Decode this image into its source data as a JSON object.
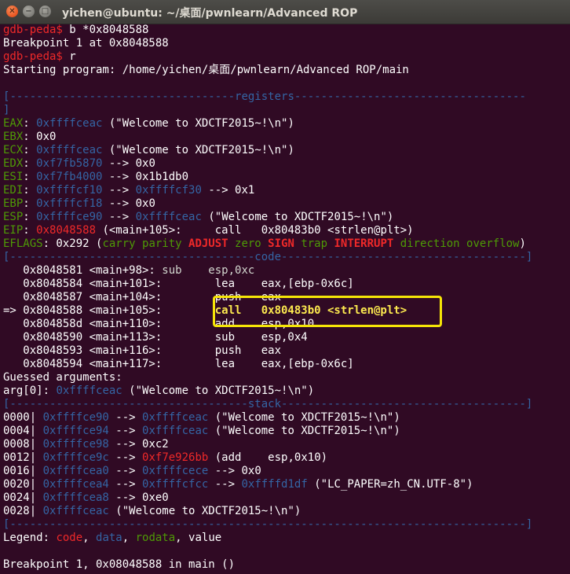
{
  "window": {
    "title": "yichen@ubuntu: ~/桌面/pwnlearn/Advanced ROP",
    "close_glyph": "✕",
    "min_glyph": "−",
    "max_glyph": "□"
  },
  "lines": [
    [
      {
        "t": "gdb-peda$ ",
        "c": "red"
      },
      {
        "t": "b *0x8048588",
        "c": "white"
      }
    ],
    [
      {
        "t": "Breakpoint 1 at 0x8048588",
        "c": "white"
      }
    ],
    [
      {
        "t": "gdb-peda$ ",
        "c": "red"
      },
      {
        "t": "r",
        "c": "white"
      }
    ],
    [
      {
        "t": "Starting program: /home/yichen/桌面/pwnlearn/Advanced ROP/main",
        "c": "white"
      }
    ],
    [
      {
        "t": "",
        "c": "white"
      }
    ],
    [
      {
        "t": "[",
        "c": "blue"
      },
      {
        "t": "----------------------------------registers-----------------------------------",
        "c": "blue"
      }
    ],
    [
      {
        "t": "]",
        "c": "blue"
      }
    ],
    [
      {
        "t": "EAX",
        "c": "green"
      },
      {
        "t": ": ",
        "c": "white"
      },
      {
        "t": "0xffffceac",
        "c": "blue"
      },
      {
        "t": " (\"Welcome to XDCTF2015~!\\n\")",
        "c": "white"
      }
    ],
    [
      {
        "t": "EBX",
        "c": "green"
      },
      {
        "t": ": 0x0",
        "c": "white"
      }
    ],
    [
      {
        "t": "ECX",
        "c": "green"
      },
      {
        "t": ": ",
        "c": "white"
      },
      {
        "t": "0xffffceac",
        "c": "blue"
      },
      {
        "t": " (\"Welcome to XDCTF2015~!\\n\")",
        "c": "white"
      }
    ],
    [
      {
        "t": "EDX",
        "c": "green"
      },
      {
        "t": ": ",
        "c": "white"
      },
      {
        "t": "0xf7fb5870",
        "c": "blue"
      },
      {
        "t": " --> 0x0",
        "c": "white"
      }
    ],
    [
      {
        "t": "ESI",
        "c": "green"
      },
      {
        "t": ": ",
        "c": "white"
      },
      {
        "t": "0xf7fb4000",
        "c": "blue"
      },
      {
        "t": " --> 0x1b1db0",
        "c": "white"
      }
    ],
    [
      {
        "t": "EDI",
        "c": "green"
      },
      {
        "t": ": ",
        "c": "white"
      },
      {
        "t": "0xffffcf10",
        "c": "blue"
      },
      {
        "t": " --> ",
        "c": "white"
      },
      {
        "t": "0xffffcf30",
        "c": "blue"
      },
      {
        "t": " --> 0x1",
        "c": "white"
      }
    ],
    [
      {
        "t": "EBP",
        "c": "green"
      },
      {
        "t": ": ",
        "c": "white"
      },
      {
        "t": "0xffffcf18",
        "c": "blue"
      },
      {
        "t": " --> 0x0",
        "c": "white"
      }
    ],
    [
      {
        "t": "ESP",
        "c": "green"
      },
      {
        "t": ": ",
        "c": "white"
      },
      {
        "t": "0xffffce90",
        "c": "blue"
      },
      {
        "t": " --> ",
        "c": "white"
      },
      {
        "t": "0xffffceac",
        "c": "blue"
      },
      {
        "t": " (\"Welcome to XDCTF2015~!\\n\")",
        "c": "white"
      }
    ],
    [
      {
        "t": "EIP",
        "c": "green"
      },
      {
        "t": ": ",
        "c": "white"
      },
      {
        "t": "0x8048588",
        "c": "red"
      },
      {
        "t": " (<main+105>:     call   0x80483b0 <strlen@plt>)",
        "c": "white"
      }
    ],
    [
      {
        "t": "EFLAGS",
        "c": "green"
      },
      {
        "t": ": 0x292 (",
        "c": "white"
      },
      {
        "t": "carry parity ",
        "c": "green"
      },
      {
        "t": "ADJUST",
        "c": "red-b"
      },
      {
        "t": " zero ",
        "c": "green"
      },
      {
        "t": "SIGN",
        "c": "red-b"
      },
      {
        "t": " trap ",
        "c": "green"
      },
      {
        "t": "INTERRUPT",
        "c": "red-b"
      },
      {
        "t": " direction overflow",
        "c": "green"
      },
      {
        "t": ")",
        "c": "white"
      }
    ],
    [
      {
        "t": "[-------------------------------------code-------------------------------------]",
        "c": "blue"
      }
    ],
    [
      {
        "t": "   0x8048581 <main+98>:",
        "c": "white"
      },
      {
        "t": " sub    esp,0xc",
        "c": "gray"
      }
    ],
    [
      {
        "t": "   0x8048584 <main+101>:        lea    eax,[ebp-0x6c]",
        "c": "white"
      }
    ],
    [
      {
        "t": "   0x8048587 <main+104>:        push   eax",
        "c": "white"
      }
    ],
    [
      {
        "t": "=> 0x8048588 <main+105>:        ",
        "c": "white"
      },
      {
        "t": "call   0x80483b0 <strlen@plt>",
        "c": "yellow-b"
      }
    ],
    [
      {
        "t": "   0x804858d <main+110>:        add    esp,0x10",
        "c": "white"
      }
    ],
    [
      {
        "t": "   0x8048590 <main+113>:        sub    esp,0x4",
        "c": "white"
      }
    ],
    [
      {
        "t": "   0x8048593 <main+116>:        push   eax",
        "c": "white"
      }
    ],
    [
      {
        "t": "   0x8048594 <main+117>:        lea    eax,[ebp-0x6c]",
        "c": "white"
      }
    ],
    [
      {
        "t": "Guessed arguments:",
        "c": "white"
      }
    ],
    [
      {
        "t": "arg[0]: ",
        "c": "white"
      },
      {
        "t": "0xffffceac",
        "c": "blue"
      },
      {
        "t": " (\"Welcome to XDCTF2015~!\\n\")",
        "c": "white"
      }
    ],
    [
      {
        "t": "[------------------------------------stack-------------------------------------]",
        "c": "blue"
      }
    ],
    [
      {
        "t": "0000| ",
        "c": "white"
      },
      {
        "t": "0xffffce90",
        "c": "blue"
      },
      {
        "t": " --> ",
        "c": "white"
      },
      {
        "t": "0xffffceac",
        "c": "blue"
      },
      {
        "t": " (\"Welcome to XDCTF2015~!\\n\")",
        "c": "white"
      }
    ],
    [
      {
        "t": "0004| ",
        "c": "white"
      },
      {
        "t": "0xffffce94",
        "c": "blue"
      },
      {
        "t": " --> ",
        "c": "white"
      },
      {
        "t": "0xffffceac",
        "c": "blue"
      },
      {
        "t": " (\"Welcome to XDCTF2015~!\\n\")",
        "c": "white"
      }
    ],
    [
      {
        "t": "0008| ",
        "c": "white"
      },
      {
        "t": "0xffffce98",
        "c": "blue"
      },
      {
        "t": " --> 0xc2",
        "c": "white"
      }
    ],
    [
      {
        "t": "0012| ",
        "c": "white"
      },
      {
        "t": "0xffffce9c",
        "c": "blue"
      },
      {
        "t": " --> ",
        "c": "white"
      },
      {
        "t": "0xf7e926bb",
        "c": "red"
      },
      {
        "t": " (add    esp,0x10)",
        "c": "white"
      }
    ],
    [
      {
        "t": "0016| ",
        "c": "white"
      },
      {
        "t": "0xffffcea0",
        "c": "blue"
      },
      {
        "t": " --> ",
        "c": "white"
      },
      {
        "t": "0xffffcece",
        "c": "blue"
      },
      {
        "t": " --> 0x0",
        "c": "white"
      }
    ],
    [
      {
        "t": "0020| ",
        "c": "white"
      },
      {
        "t": "0xffffcea4",
        "c": "blue"
      },
      {
        "t": " --> ",
        "c": "white"
      },
      {
        "t": "0xffffcfcc",
        "c": "blue"
      },
      {
        "t": " --> ",
        "c": "white"
      },
      {
        "t": "0xffffd1df",
        "c": "blue"
      },
      {
        "t": " (\"LC_PAPER=zh_CN.UTF-8\")",
        "c": "white"
      }
    ],
    [
      {
        "t": "0024| ",
        "c": "white"
      },
      {
        "t": "0xffffcea8",
        "c": "blue"
      },
      {
        "t": " --> 0xe0",
        "c": "white"
      }
    ],
    [
      {
        "t": "0028| ",
        "c": "white"
      },
      {
        "t": "0xffffceac",
        "c": "blue"
      },
      {
        "t": " (\"Welcome to XDCTF2015~!\\n\")",
        "c": "white"
      }
    ],
    [
      {
        "t": "[------------------------------------------------------------------------------]",
        "c": "blue"
      }
    ],
    [
      {
        "t": "Legend: ",
        "c": "white"
      },
      {
        "t": "code",
        "c": "red"
      },
      {
        "t": ", ",
        "c": "white"
      },
      {
        "t": "data",
        "c": "blue"
      },
      {
        "t": ", ",
        "c": "white"
      },
      {
        "t": "rodata",
        "c": "green"
      },
      {
        "t": ", value",
        "c": "white"
      }
    ],
    [
      {
        "t": "",
        "c": "white"
      }
    ],
    [
      {
        "t": "Breakpoint 1, 0x08048588 in main ()",
        "c": "white"
      }
    ]
  ]
}
